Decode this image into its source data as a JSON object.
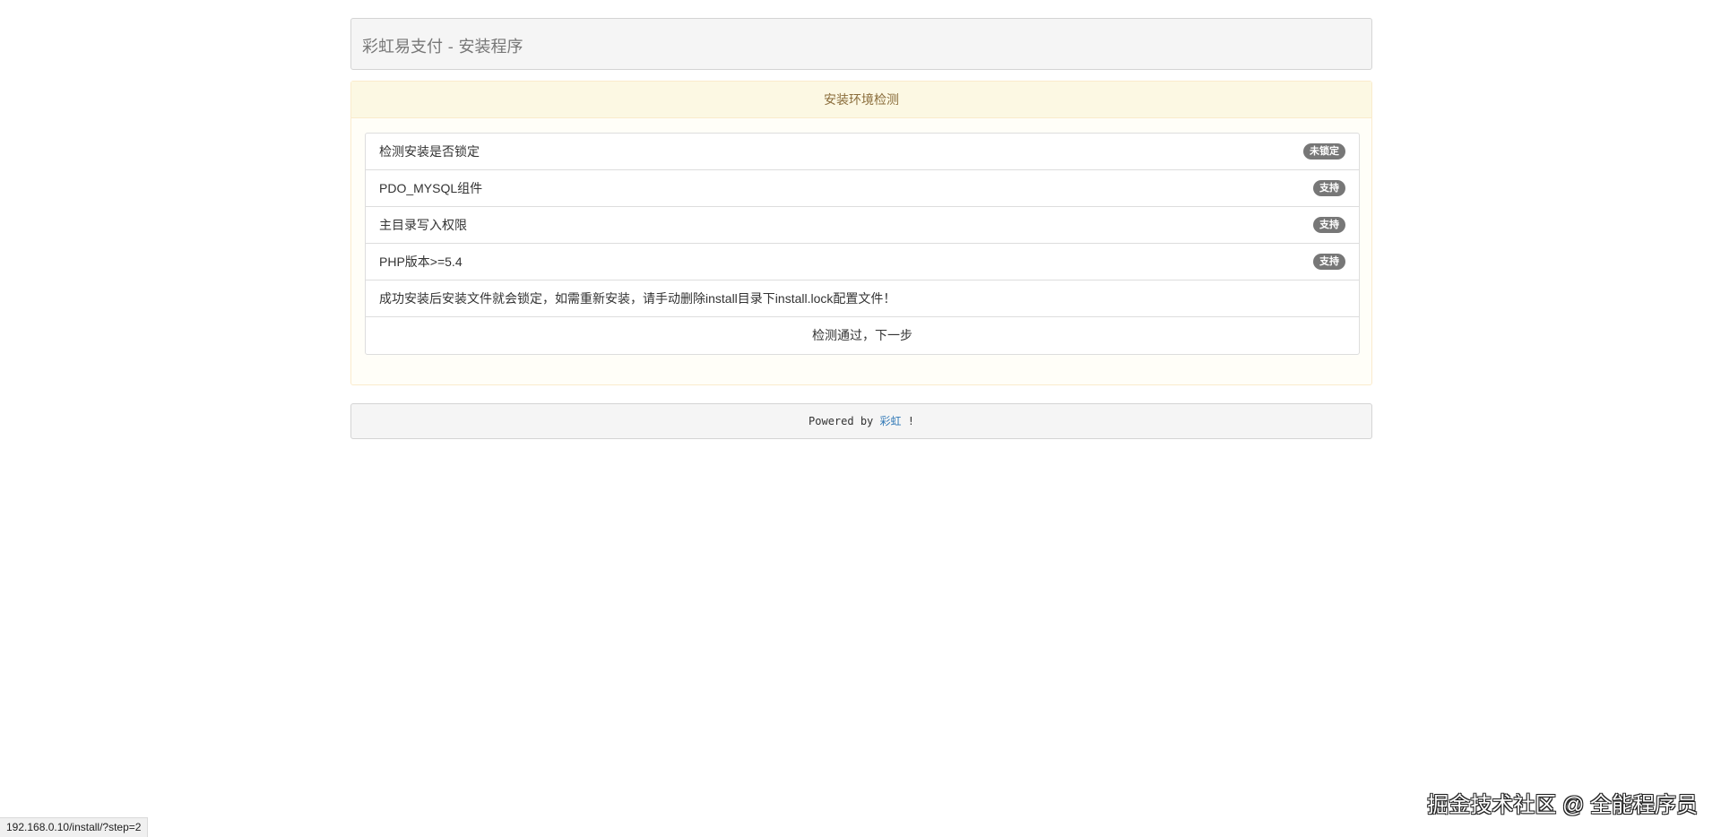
{
  "header": {
    "title": "彩虹易支付 - 安装程序"
  },
  "check_panel": {
    "heading": "安装环境检测",
    "items": [
      {
        "label": "检测安装是否锁定",
        "badge": "未锁定"
      },
      {
        "label": "PDO_MYSQL组件",
        "badge": "支持"
      },
      {
        "label": "主目录写入权限",
        "badge": "支持"
      },
      {
        "label": "PHP版本>=5.4",
        "badge": "支持"
      }
    ],
    "notice": "成功安装后安装文件就会锁定，如需重新安装，请手动删除install目录下install.lock配置文件！",
    "next_label": "检测通过，下一步"
  },
  "footer": {
    "powered_by": "Powered by",
    "link_text": "彩虹",
    "suffix": "!"
  },
  "status_bar": {
    "url": "192.168.0.10/install/?step=2"
  },
  "watermark": {
    "text": "掘金技术社区 @ 全能程序员"
  },
  "colors": {
    "warning_heading_bg": "#fcf8e3",
    "warning_text": "#8a6d3b",
    "badge_bg": "#777777",
    "link": "#337ab7"
  }
}
